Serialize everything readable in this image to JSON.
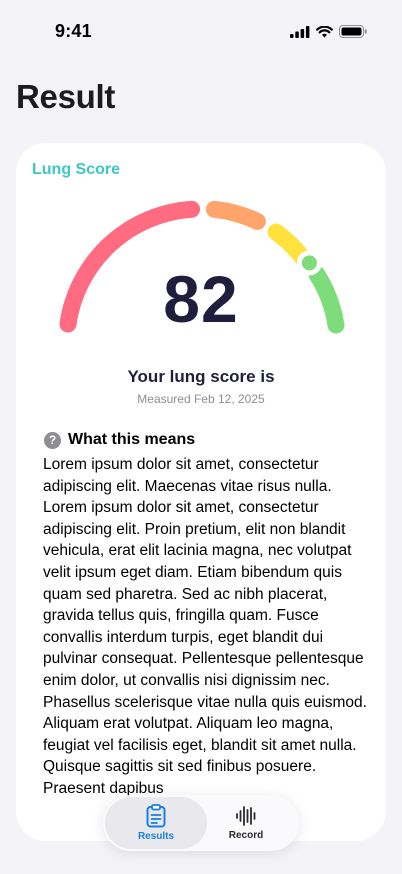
{
  "status_bar": {
    "time": "9:41"
  },
  "page": {
    "title": "Result"
  },
  "card": {
    "label": "Lung Score",
    "score": "82",
    "score_fraction": 0.82,
    "caption": "Your lung score is",
    "measured": "Measured Feb 12, 2025",
    "gauge_colors": [
      "#FF6B81",
      "#FFA46A",
      "#FFE23D",
      "#7EDC7A"
    ],
    "meaning": {
      "title": "What this means",
      "icon": "question-circle-icon",
      "body": "Lorem ipsum dolor sit amet, consectetur adipiscing elit. Maecenas vitae risus nulla. Lorem ipsum dolor sit amet, consectetur adipiscing elit. Proin pretium, elit non blandit vehicula, erat elit lacinia magna, nec volutpat velit ipsum eget diam. Etiam bibendum quis quam sed pharetra. Sed ac nibh placerat, gravida tellus quis, fringilla quam. Fusce convallis interdum turpis, eget blandit dui pulvinar consequat. Pellentesque pellentesque enim dolor, ut convallis nisi dignissim nec. Phasellus scelerisque vitae nulla quis euismod. Aliquam erat volutpat. Aliquam leo magna, feugiat vel facilisis eget, blandit sit amet nulla. Quisque sagittis sit sed finibus posuere. Praesent dapibus"
    }
  },
  "tab_bar": {
    "tabs": [
      {
        "label": "Results",
        "icon": "clipboard-icon",
        "active": true
      },
      {
        "label": "Record",
        "icon": "waveform-icon",
        "active": false
      }
    ],
    "accent": "#1A7FE0"
  }
}
